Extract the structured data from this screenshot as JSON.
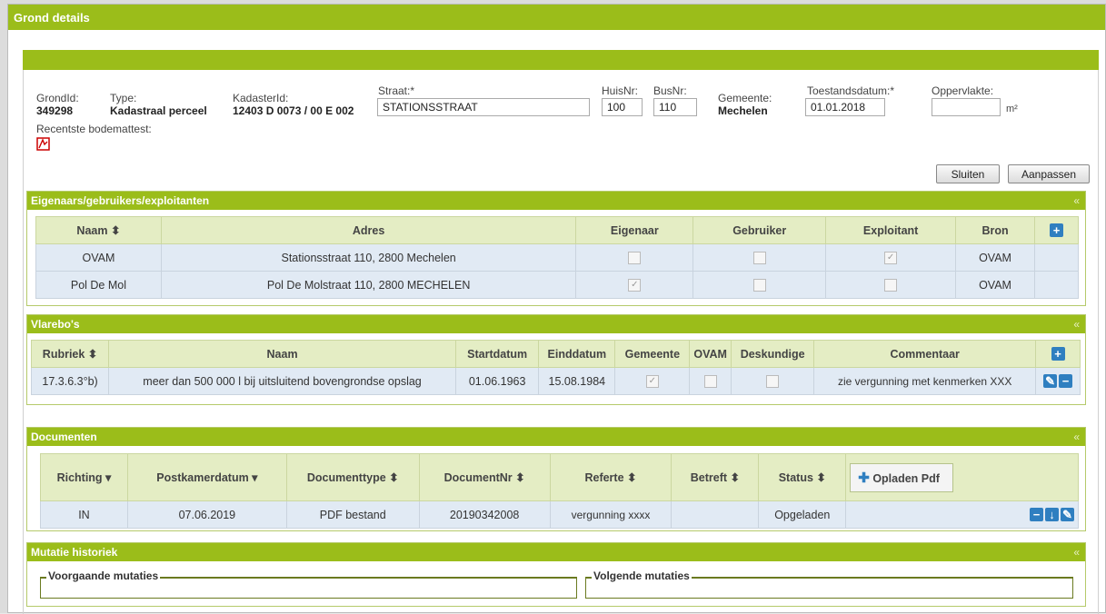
{
  "window": {
    "title": "Grond details"
  },
  "header": {
    "grondid_label": "GrondId:",
    "grondid_value": "349298",
    "type_label": "Type:",
    "type_value": "Kadastraal perceel",
    "kadasterid_label": "KadasterId:",
    "kadasterid_value": "12403 D 0073 / 00 E 002",
    "straat_label": "Straat:*",
    "straat_value": "STATIONSSTRAAT",
    "huisnr_label": "HuisNr:",
    "huisnr_value": "100",
    "busnr_label": "BusNr:",
    "busnr_value": "110",
    "gemeente_label": "Gemeente:",
    "gemeente_value": "Mechelen",
    "toestandsdatum_label": "Toestandsdatum:*",
    "toestandsdatum_value": "01.01.2018",
    "oppervlakte_label": "Oppervlakte:",
    "oppervlakte_value": "",
    "oppervlakte_unit": "m²",
    "bodemattest_label": "Recentste bodemattest:",
    "sluiten": "Sluiten",
    "aanpassen": "Aanpassen"
  },
  "eigenaars": {
    "title": "Eigenaars/gebruikers/exploitanten",
    "collapse": "«",
    "headers": [
      "Naam ⬍",
      "Adres",
      "Eigenaar",
      "Gebruiker",
      "Exploitant",
      "Bron"
    ],
    "rows": [
      {
        "naam": "OVAM",
        "adres": "Stationsstraat 110, 2800 Mechelen",
        "eigenaar": false,
        "gebruiker": false,
        "exploitant": true,
        "bron": "OVAM"
      },
      {
        "naam": "Pol De Mol",
        "adres": "Pol De Molstraat 110, 2800 MECHELEN",
        "eigenaar": true,
        "gebruiker": false,
        "exploitant": false,
        "bron": "OVAM"
      }
    ]
  },
  "vlarebo": {
    "title": "Vlarebo's",
    "collapse": "«",
    "headers": [
      "Rubriek ⬍",
      "Naam",
      "Startdatum",
      "Einddatum",
      "Gemeente",
      "OVAM",
      "Deskundige",
      "Commentaar"
    ],
    "rows": [
      {
        "rubriek": "17.3.6.3°b)",
        "naam": "meer dan 500 000 l bij uitsluitend bovengrondse opslag",
        "start": "01.06.1963",
        "eind": "15.08.1984",
        "gemeente": true,
        "ovam": false,
        "deskundige": false,
        "commentaar": "zie vergunning met kenmerken XXX"
      }
    ]
  },
  "documenten": {
    "title": "Documenten",
    "collapse": "«",
    "headers": [
      "Richting ▾",
      "Postkamerdatum ▾",
      "Documenttype ⬍",
      "DocumentNr ⬍",
      "Referte ⬍",
      "Betreft ⬍",
      "Status ⬍"
    ],
    "upload": "Opladen Pdf",
    "rows": [
      {
        "richting": "IN",
        "postkamerdatum": "07.06.2019",
        "documenttype": "PDF bestand",
        "documentnr": "20190342008",
        "referte": "vergunning xxxx",
        "betreft": "",
        "status": "Opgeladen"
      }
    ]
  },
  "mutatie": {
    "title": "Mutatie historiek",
    "collapse": "«",
    "voorgaande": "Voorgaande mutaties",
    "volgende": "Volgende mutaties"
  },
  "colors": {
    "accent": "#9bbd1a",
    "header_cell": "#e4edc4",
    "row": "#e1eaf4",
    "icon": "#2f7fc0"
  }
}
